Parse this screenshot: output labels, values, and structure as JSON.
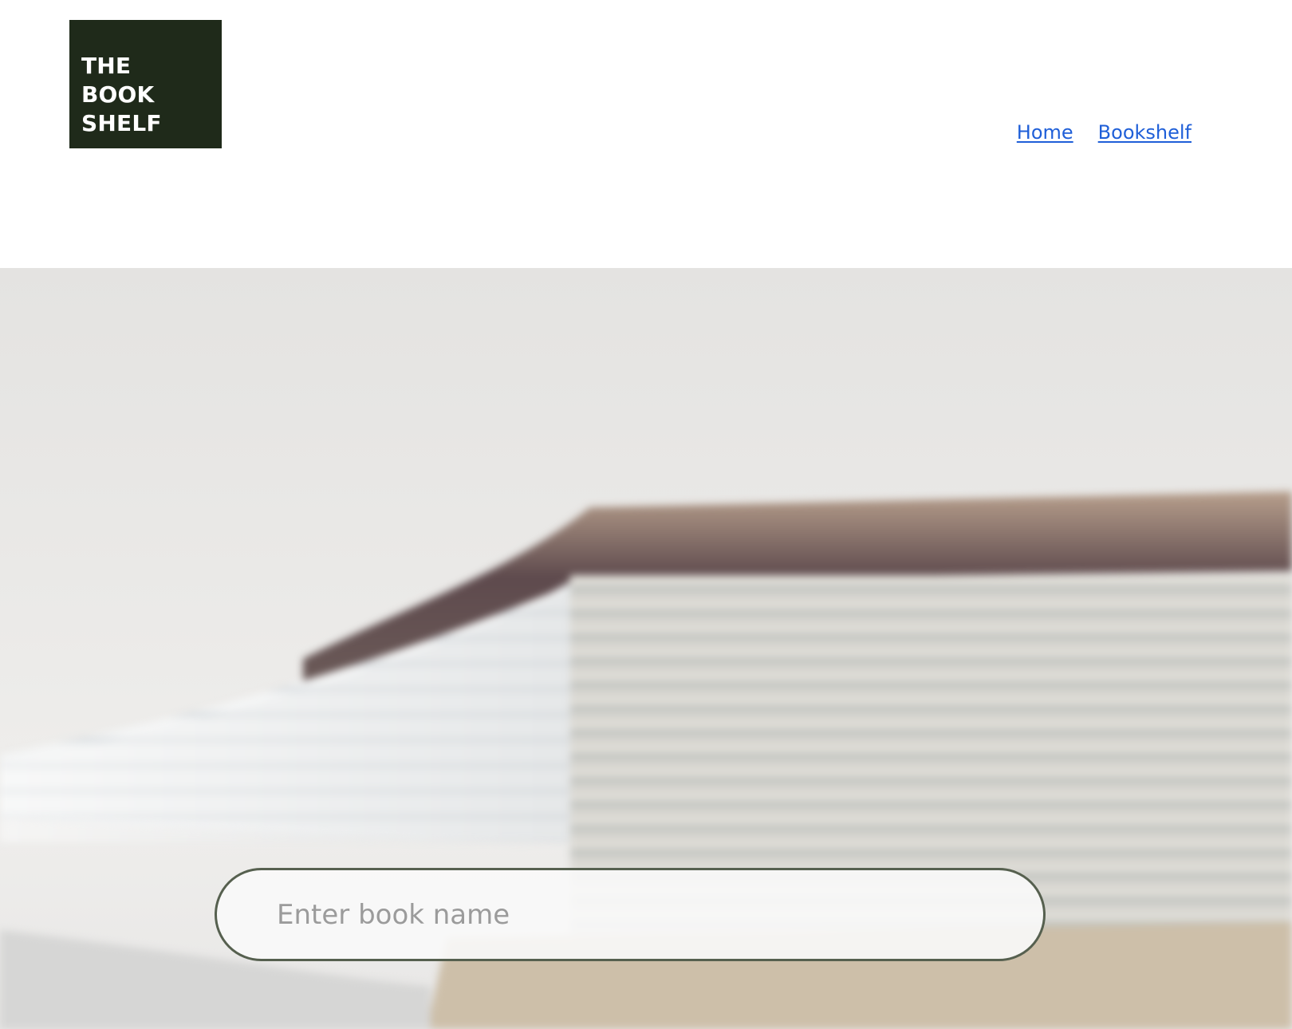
{
  "brand": {
    "logo_lines": [
      "THE",
      "BOOK",
      "SHELF"
    ],
    "logo_bg": "#1f2a1a",
    "logo_fg": "#ffffff"
  },
  "nav": {
    "links": [
      {
        "label": "Home"
      },
      {
        "label": "Bookshelf"
      }
    ],
    "link_color": "#1f5fd8"
  },
  "hero": {
    "image": "blurred-closeup-of-book-pages"
  },
  "search": {
    "placeholder": "Enter book name",
    "value": "",
    "border_color": "#56604f"
  }
}
